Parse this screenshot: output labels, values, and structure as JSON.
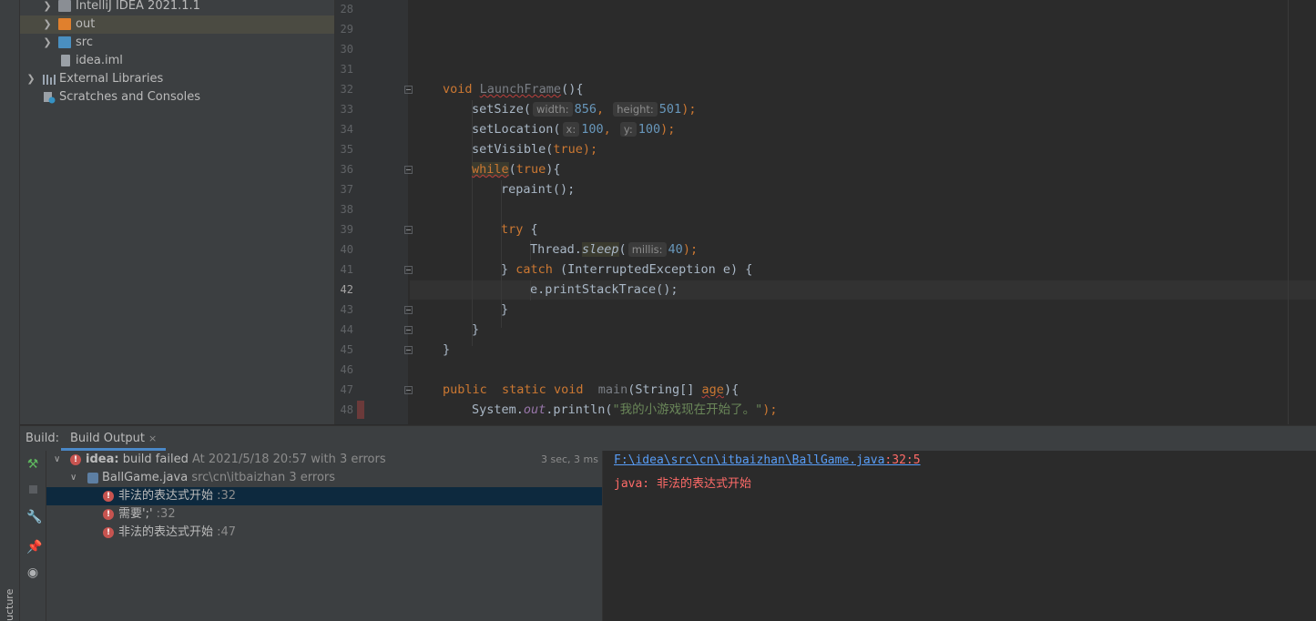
{
  "project_tree": {
    "items": [
      {
        "label": "IntelliJ IDEA 2021.1.1",
        "icon": "folder-icon",
        "expandable": true
      },
      {
        "label": "out",
        "icon": "folder-icon",
        "expandable": true
      },
      {
        "label": "src",
        "icon": "source-folder-icon",
        "expandable": true
      },
      {
        "label": "idea.iml",
        "icon": "module-file-icon",
        "expandable": false
      },
      {
        "label": "External Libraries",
        "icon": "libraries-icon",
        "expandable": true
      },
      {
        "label": "Scratches and Consoles",
        "icon": "scratches-icon",
        "expandable": false
      }
    ]
  },
  "left_strip": {
    "structure_label": "ucture"
  },
  "editor": {
    "line_numbers": [
      "28",
      "29",
      "30",
      "31",
      "32",
      "33",
      "34",
      "35",
      "36",
      "37",
      "38",
      "39",
      "40",
      "41",
      "42",
      "43",
      "44",
      "45",
      "46",
      "47",
      "48"
    ],
    "current_line": "42",
    "code": {
      "l32": {
        "kw": "void",
        "name": "LaunchFrame",
        "rest": "(){"
      },
      "l33": {
        "call": "setSize(",
        "hint1": "width:",
        "v1": "856",
        "sep": ", ",
        "hint2": "height:",
        "v2": "501",
        "end": ");"
      },
      "l34": {
        "call": "setLocation(",
        "hint1": "x:",
        "v1": "100",
        "sep": ", ",
        "hint2": "y:",
        "v2": "100",
        "end": ");"
      },
      "l35": {
        "call": "setVisible(",
        "kw": "true",
        "end": ");"
      },
      "l36": {
        "kw": "while",
        "open": "(",
        "kw2": "true",
        "end": "){"
      },
      "l37": {
        "text": "repaint();"
      },
      "l39": {
        "kw": "try",
        "end": " {"
      },
      "l40": {
        "obj": "Thread.",
        "method": "sleep",
        "open": "(",
        "hint": "millis:",
        "v": "40",
        "end": ");"
      },
      "l41": {
        "start": "} ",
        "kw": "catch",
        "rest": " (InterruptedException e) {"
      },
      "l42": {
        "text": "e.printStackTrace();"
      },
      "l43": {
        "text": "}"
      },
      "l44": {
        "text": "}"
      },
      "l45": {
        "text": "}"
      },
      "l47": {
        "kw1": "public",
        "kw2": "static",
        "kw3": "void",
        "name": "main",
        "rest1": "(String[] ",
        "param": "age",
        "rest2": "){"
      },
      "l48": {
        "obj": "System.",
        "field": "out",
        "call": ".println(",
        "str": "\"我的小游戏现在开始了。\"",
        "end": ");"
      }
    }
  },
  "build": {
    "label": "Build:",
    "tab_label": "Build Output",
    "close_glyph": "×",
    "root": {
      "name": "idea:",
      "status": "build failed",
      "detail": "At 2021/5/18 20:57 with 3 errors",
      "duration": "3 sec, 3 ms"
    },
    "file": {
      "name": "BallGame.java",
      "detail": "src\\cn\\itbaizhan 3 errors"
    },
    "errors": [
      {
        "message": "非法的表达式开始",
        "line": ":32"
      },
      {
        "message": "需要';'",
        "line": ":32"
      },
      {
        "message": "非法的表达式开始",
        "line": ":47"
      }
    ],
    "console": {
      "path": "F:\\idea\\src\\cn\\itbaizhan\\BallGame.java",
      "position": ":32:5",
      "error_text": "java: 非法的表达式开始"
    }
  }
}
